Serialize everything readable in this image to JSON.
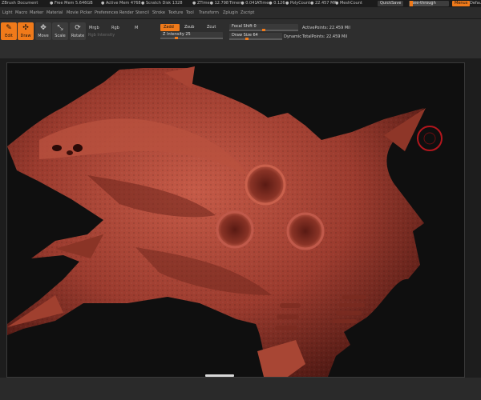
{
  "status": {
    "doc": "ZBrush Document",
    "free_mem": "● Free Mem 5.646GB",
    "active_mem": "● Active Mem 4768",
    "scratch": "● Scratch Disk 1328",
    "ztime": "● ZTime● 12.798",
    "timer": "Timer● 0.041",
    "atime": "ATime● 0.126",
    "polycount": "● PolyCount● 22.457 MP",
    "meshcount": "● MeshCount",
    "quicksave": "QuickSave",
    "see_through": "See-through",
    "see_through_value": "0",
    "menus": "Menus",
    "defaultscript": "DefaultZScript"
  },
  "menubar": [
    "Light",
    "Macro",
    "Marker",
    "Material",
    "Movie",
    "Picker",
    "Preferences",
    "Render",
    "Stencil",
    "Stroke",
    "Texture",
    "Tool",
    "Transform",
    "Zplugin",
    "Zscript"
  ],
  "toolbar": {
    "edit": "Edit",
    "draw": "Draw",
    "move": "Move",
    "scale": "Scale",
    "rotate": "Rotate",
    "mrgb": "Mrgb",
    "rgb": "Rgb",
    "m": "M",
    "rgb_intensity": "Rgb Intensity",
    "zadd": "Zadd",
    "zsub": "Zsub",
    "zcut": "Zcut",
    "z_intensity": "Z Intensity 25",
    "z_intensity_value": 25,
    "focal_shift": "Focal Shift 0",
    "focal_shift_value": 0,
    "draw_size": "Draw Size 64",
    "draw_size_value": 64,
    "dynamic": "Dynamic",
    "active_points": "ActivePoints: 22.459 Mil",
    "total_points": "TotalPoints: 22.459 Mil"
  },
  "colors": {
    "accent": "#f07a1a",
    "clay": "#9b3b2e",
    "clay_light": "#c9604c",
    "clay_dark": "#4a1611",
    "background": "#0f0f0f"
  }
}
